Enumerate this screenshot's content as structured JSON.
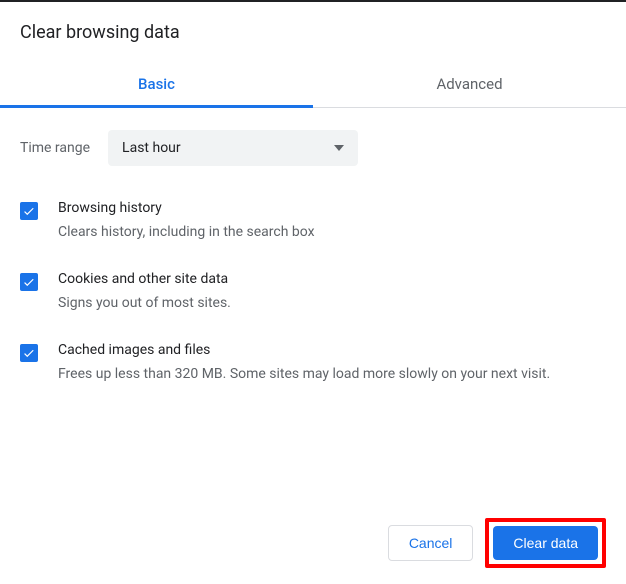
{
  "dialog": {
    "title": "Clear browsing data"
  },
  "tabs": {
    "basic": "Basic",
    "advanced": "Advanced"
  },
  "timerange": {
    "label": "Time range",
    "value": "Last hour"
  },
  "options": {
    "history": {
      "title": "Browsing history",
      "sub": "Clears history, including in the search box"
    },
    "cookies": {
      "title": "Cookies and other site data",
      "sub": "Signs you out of most sites."
    },
    "cache": {
      "title": "Cached images and files",
      "sub": "Frees up less than 320 MB. Some sites may load more slowly on your next visit."
    }
  },
  "buttons": {
    "cancel": "Cancel",
    "clear": "Clear data"
  }
}
